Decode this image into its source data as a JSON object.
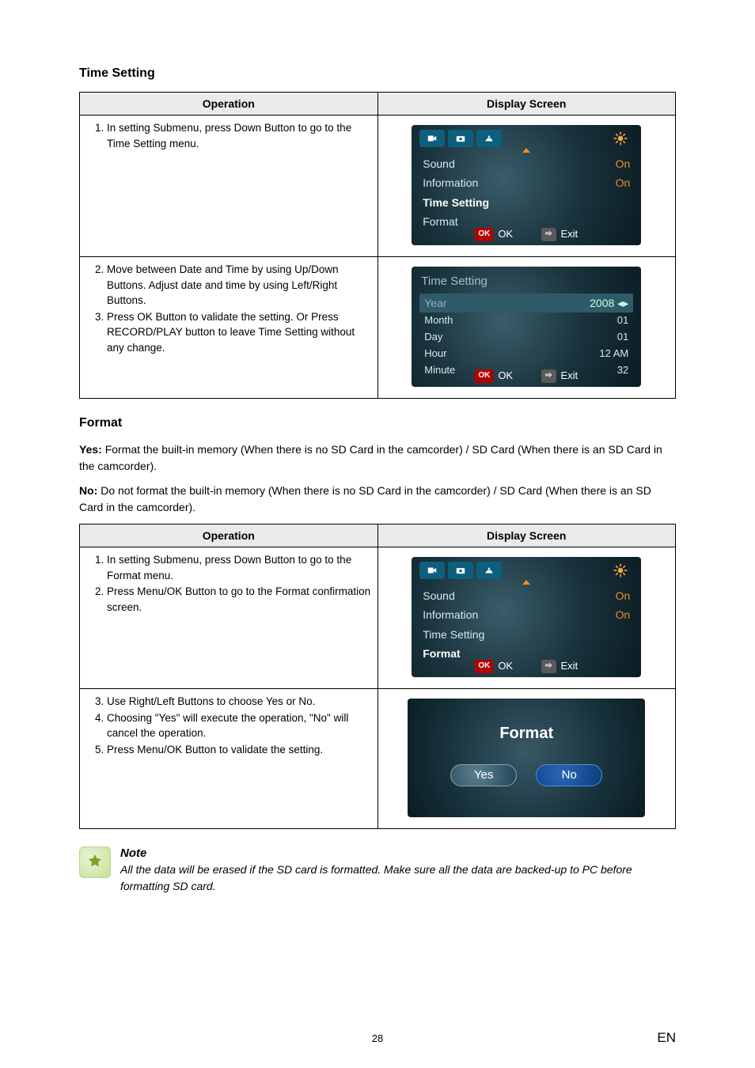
{
  "section1": {
    "title": "Time Setting"
  },
  "table_headers": {
    "operation": "Operation",
    "display_screen": "Display Screen"
  },
  "table1": {
    "row1": {
      "step1": "1. In setting Submenu, press Down Button to go to the Time Setting menu."
    },
    "row2": {
      "step2a": "2. Move between Date and Time by using Up/Down Buttons. Adjust date and time by using Left/Right Buttons.",
      "step2b": "3. Press OK Button to validate the setting. Or Press RECORD/PLAY button to leave Time Setting without any change."
    }
  },
  "screen_menu": {
    "sound": {
      "label": "Sound",
      "value": "On"
    },
    "info": {
      "label": "Information",
      "value": "On"
    },
    "timesetting": {
      "label": "Time Setting"
    },
    "format": {
      "label": "Format"
    },
    "ok": "OK",
    "exit": "Exit"
  },
  "screen_time": {
    "title": "Time  Setting",
    "year": {
      "label": "Year",
      "value": "2008"
    },
    "month": {
      "label": "Month",
      "value": "01"
    },
    "day": {
      "label": "Day",
      "value": "01"
    },
    "hour": {
      "label": "Hour",
      "value": "12 AM"
    },
    "minute": {
      "label": "Minute",
      "value": "32"
    }
  },
  "section2": {
    "title": "Format",
    "yes_label": "Yes:",
    "yes_text": " Format the built-in memory (When there is no SD Card in the camcorder) / SD Card (When there is an SD Card in the camcorder).",
    "no_label": "No:",
    "no_text": " Do not format the built-in memory (When there is no SD Card in the camcorder) / SD Card (When there is an SD Card in the camcorder)."
  },
  "table2": {
    "row1": {
      "step1": "1. In setting Submenu, press Down Button to go to the Format menu.",
      "step2": "2. Press Menu/OK Button to go to the Format confirmation screen."
    },
    "row2": {
      "step3": "3. Use Right/Left Buttons to choose Yes or No.",
      "step4": "4. Choosing \"Yes\" will execute the operation, \"No\" will cancel the operation.",
      "step5": "5. Press Menu/OK Button to validate the setting."
    }
  },
  "screen_format": {
    "title": "Format",
    "yes": "Yes",
    "no": "No"
  },
  "note": {
    "head": "Note",
    "text": "All the data will be erased if the SD card is formatted. Make sure all the data are backed-up to PC before formatting SD card."
  },
  "footer": {
    "pagenum": "28",
    "lang": "EN"
  }
}
